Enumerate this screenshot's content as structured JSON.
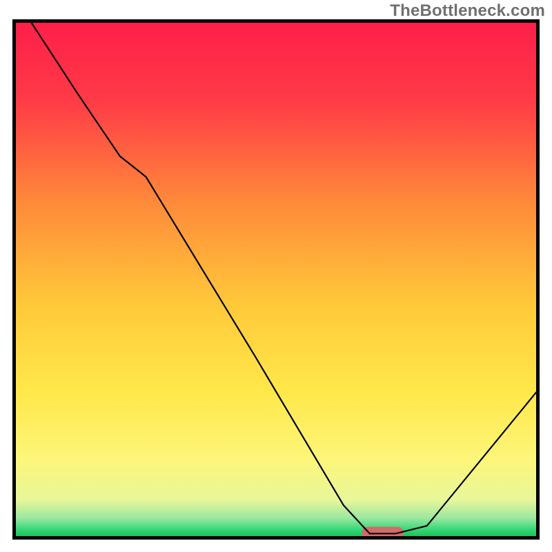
{
  "watermark": "TheBottleneck.com",
  "colors": {
    "gradient_stops": [
      {
        "offset": 0.0,
        "color": "#ff1f4a"
      },
      {
        "offset": 0.15,
        "color": "#ff3a47"
      },
      {
        "offset": 0.35,
        "color": "#ff8a3a"
      },
      {
        "offset": 0.55,
        "color": "#ffc93a"
      },
      {
        "offset": 0.72,
        "color": "#ffe84a"
      },
      {
        "offset": 0.85,
        "color": "#fdf67a"
      },
      {
        "offset": 0.93,
        "color": "#e7f79a"
      },
      {
        "offset": 0.965,
        "color": "#9be7a0"
      },
      {
        "offset": 0.985,
        "color": "#3fd97a"
      },
      {
        "offset": 1.0,
        "color": "#18c45c"
      }
    ],
    "curve": "#000000",
    "border": "#000000",
    "marker": "#d46a6a"
  },
  "chart_data": {
    "type": "line",
    "title": "",
    "xlabel": "",
    "ylabel": "",
    "xlim": [
      0,
      100
    ],
    "ylim": [
      0,
      100
    ],
    "grid": false,
    "legend": false,
    "series": [
      {
        "name": "bottleneck-curve",
        "x": [
          3,
          12,
          20,
          25,
          46,
          63,
          68,
          73,
          79,
          100
        ],
        "y": [
          100,
          86,
          74,
          70,
          35,
          6,
          0.5,
          0.5,
          2,
          28
        ]
      }
    ],
    "marker": {
      "x_center": 70.5,
      "y": 0.5,
      "width": 8,
      "height": 2.6
    }
  }
}
